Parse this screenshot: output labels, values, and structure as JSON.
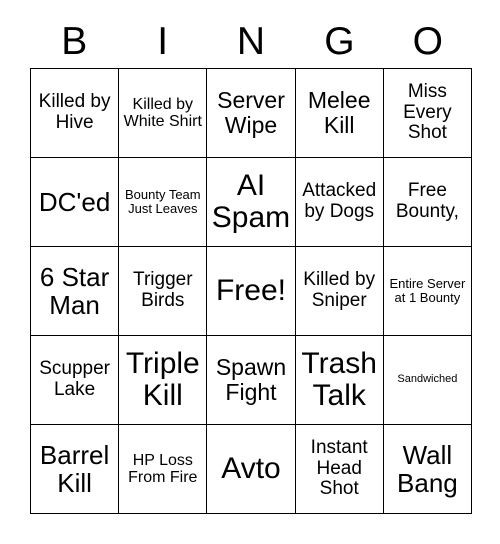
{
  "card": {
    "title": "BINGO",
    "header_letters": [
      "B",
      "I",
      "N",
      "G",
      "O"
    ],
    "grid_size": "5x5",
    "free_space": "Free!",
    "colors": {
      "background": "#ffffff",
      "text": "#000000",
      "grid_line": "#000000"
    },
    "rows": [
      [
        {
          "label": "Killed by Hive",
          "size": "md"
        },
        {
          "label": "Killed by White Shirt",
          "size": "sm"
        },
        {
          "label": "Server Wipe",
          "size": "lg"
        },
        {
          "label": "Melee Kill",
          "size": "lg"
        },
        {
          "label": "Miss Every Shot",
          "size": "md"
        }
      ],
      [
        {
          "label": "DC'ed",
          "size": "xl"
        },
        {
          "label": "Bounty Team Just Leaves",
          "size": "xs"
        },
        {
          "label": "AI Spam",
          "size": "xxl"
        },
        {
          "label": "Attacked by Dogs",
          "size": "md"
        },
        {
          "label": "Free Bounty,",
          "size": "md"
        }
      ],
      [
        {
          "label": "6 Star Man",
          "size": "xl"
        },
        {
          "label": "Trigger Birds",
          "size": "md"
        },
        {
          "label": "Free!",
          "size": "xxl"
        },
        {
          "label": "Killed by Sniper",
          "size": "md"
        },
        {
          "label": "Entire Server at 1 Bounty",
          "size": "xs"
        }
      ],
      [
        {
          "label": "Scupper Lake",
          "size": "md"
        },
        {
          "label": "Triple Kill",
          "size": "xxl"
        },
        {
          "label": "Spawn Fight",
          "size": "lg"
        },
        {
          "label": "Trash Talk",
          "size": "xxl"
        },
        {
          "label": "Sandwiched",
          "size": "xxs"
        }
      ],
      [
        {
          "label": "Barrel Kill",
          "size": "xl"
        },
        {
          "label": "HP Loss From Fire",
          "size": "sm"
        },
        {
          "label": "Avto",
          "size": "xxl"
        },
        {
          "label": "Instant Head Shot",
          "size": "md"
        },
        {
          "label": "Wall Bang",
          "size": "xl"
        }
      ]
    ]
  }
}
